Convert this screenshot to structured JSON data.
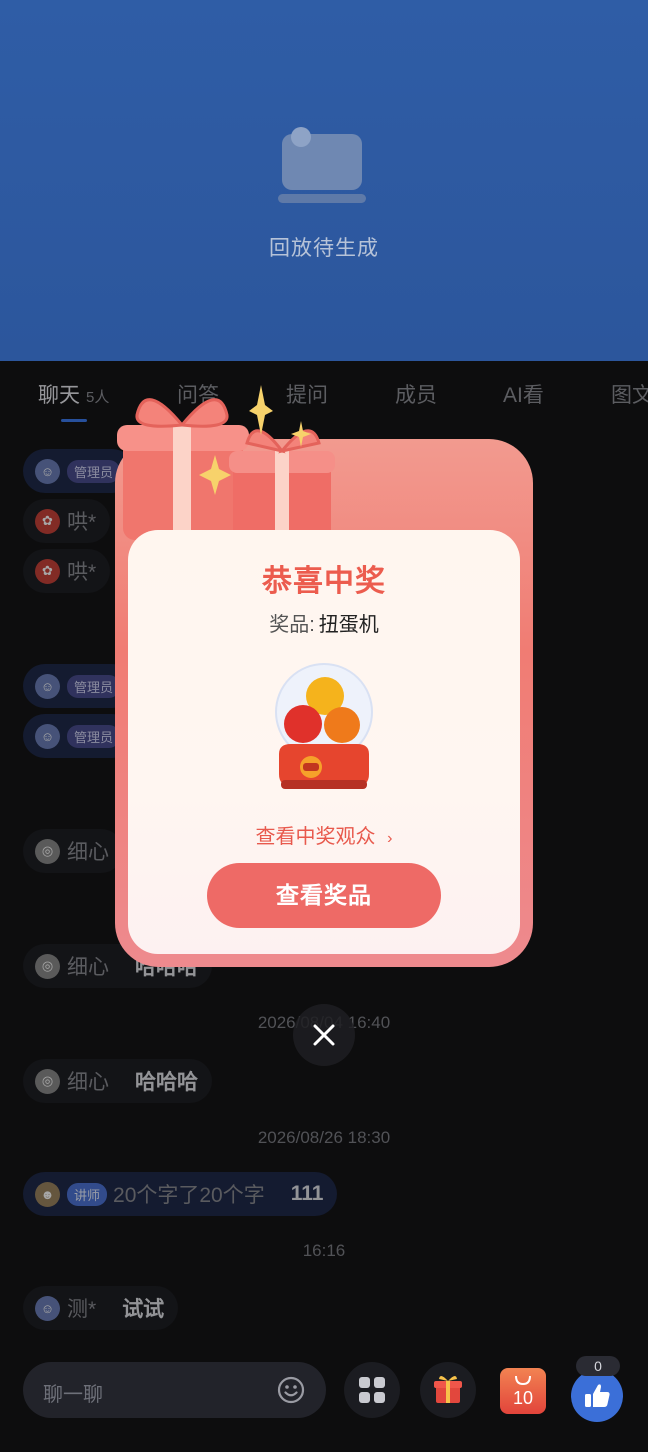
{
  "video": {
    "placeholder_text": "回放待生成"
  },
  "tabs": [
    {
      "label": "聊天",
      "count": "5人"
    },
    {
      "label": "问答"
    },
    {
      "label": "提问"
    },
    {
      "label": "成员"
    },
    {
      "label": "AI看"
    },
    {
      "label": "图文"
    }
  ],
  "chat": {
    "messages": [
      {
        "role": "管理员",
        "nick": "",
        "content": ""
      },
      {
        "role": "",
        "nick": "哄*",
        "content": ""
      },
      {
        "role": "",
        "nick": "哄*",
        "content": ""
      },
      {
        "role": "管理员",
        "nick": "",
        "content": ""
      },
      {
        "role": "管理员",
        "nick": "",
        "content": ""
      },
      {
        "role": "",
        "nick": "细心",
        "content": ""
      },
      {
        "role": "",
        "nick": "细心",
        "content": "哈哈哈"
      },
      {
        "role": "",
        "nick": "细心",
        "content": "哈哈哈"
      },
      {
        "role": "讲师",
        "nick": "20个字了20个字",
        "content": "111"
      },
      {
        "role": "",
        "nick": "测*",
        "content": "试试"
      }
    ],
    "timestamps": [
      "2026/08/04 16:40",
      "2026/08/26 18:30",
      "16:16"
    ]
  },
  "modal": {
    "title": "恭喜中奖",
    "prize_label": "奖品:",
    "prize_value": "扭蛋机",
    "view_winners": "查看中奖观众",
    "view_prize_button": "查看奖品"
  },
  "bottom_bar": {
    "input_placeholder": "聊一聊",
    "shop_count": "10",
    "like_count": "0"
  },
  "colors": {
    "accent": "#3d7bf0",
    "prize_red": "#ec5c4e",
    "button": "#ee6a66"
  }
}
